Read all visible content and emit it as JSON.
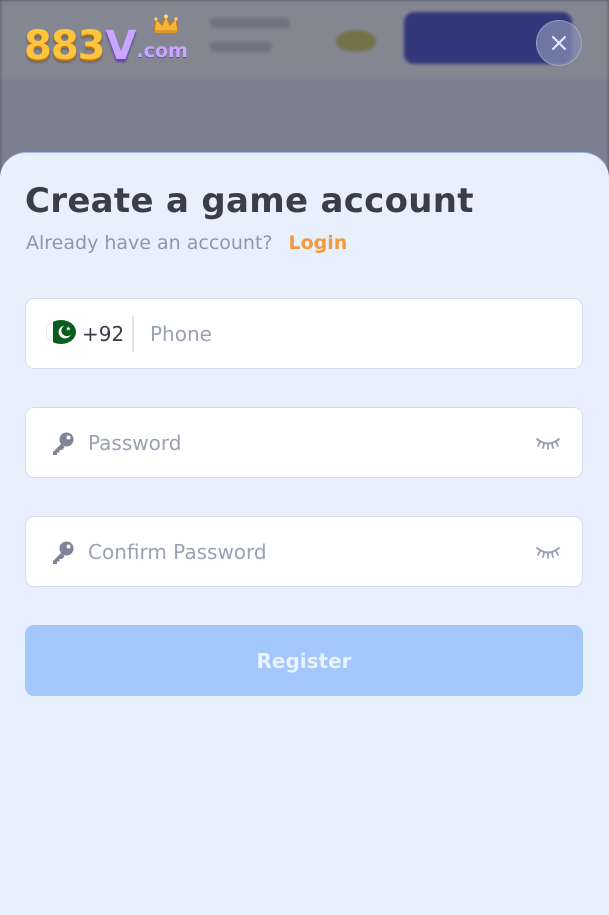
{
  "brand": {
    "logo_main": "883",
    "logo_v": "V",
    "logo_suffix": ".com"
  },
  "modal": {
    "title": "Create a game account",
    "subtitle": "Already have an account?",
    "login_link": "Login",
    "close_icon": "close-icon"
  },
  "form": {
    "phone": {
      "country_flag": "pakistan-flag-icon",
      "dial_code": "+92",
      "placeholder": "Phone",
      "value": ""
    },
    "password": {
      "placeholder": "Password",
      "value": "",
      "icon": "key-icon",
      "toggle_icon": "eye-closed-icon"
    },
    "confirm_password": {
      "placeholder": "Confirm Password",
      "value": "",
      "icon": "key-icon",
      "toggle_icon": "eye-closed-icon"
    },
    "register_label": "Register"
  },
  "colors": {
    "accent_link": "#f39a3c",
    "register_disabled": "#a3c7fb",
    "sheet_background": "#e8effd",
    "title_text": "#3a3d4a"
  }
}
